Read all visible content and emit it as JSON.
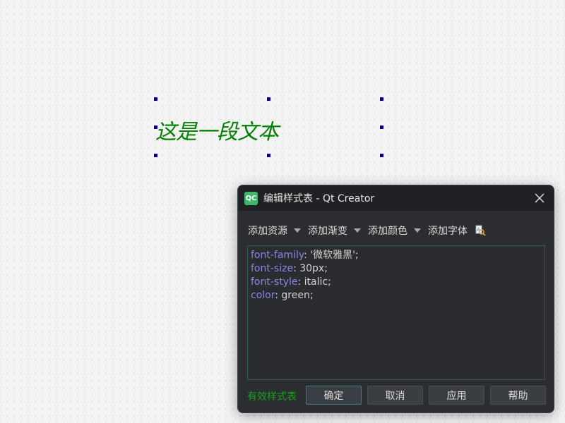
{
  "canvas": {
    "label_text": "这是一段文本"
  },
  "dialog": {
    "app_icon_text": "QC",
    "title": "编辑样式表 - Qt Creator",
    "toolbar": {
      "add_resource": "添加资源",
      "add_gradient": "添加渐变",
      "add_color": "添加颜色",
      "add_font": "添加字体"
    },
    "editor": {
      "lines": [
        {
          "prop": "font-family",
          "value": ": '微软雅黑';"
        },
        {
          "prop": "font-size",
          "value": ": 30px;"
        },
        {
          "prop": "font-style",
          "value": ": italic;"
        },
        {
          "prop": "color",
          "value": ": green;"
        }
      ]
    },
    "status": "有效样式表",
    "buttons": {
      "ok": "确定",
      "cancel": "取消",
      "apply": "应用",
      "help": "帮助"
    }
  },
  "colors": {
    "label_text": "#008000",
    "status_valid": "#1aa31a",
    "css_property": "#8a86e8",
    "selection_handle": "#000080"
  },
  "icons": {
    "close": "close-icon",
    "font_picker": "font-picker-icon",
    "dropdown": "chevron-down-icon"
  }
}
